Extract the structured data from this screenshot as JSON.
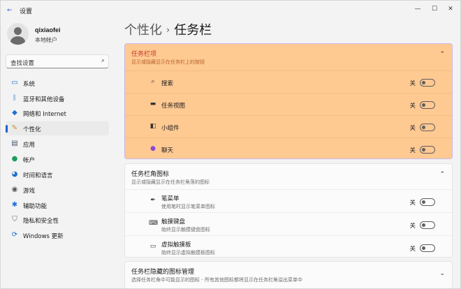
{
  "window": {
    "title": "设置",
    "app_icon": "back-arrow-icon",
    "buttons": {
      "minimize": "—",
      "maximize": "☐",
      "close": "✕"
    }
  },
  "user": {
    "name": "qixiaofei",
    "account_type": "本地帐户"
  },
  "search": {
    "placeholder": "查找设置",
    "icon": "search-icon"
  },
  "sidebar": {
    "items": [
      {
        "label": "系统",
        "icon": "monitor-icon",
        "active": false
      },
      {
        "label": "蓝牙和其他设备",
        "icon": "bluetooth-icon",
        "active": false
      },
      {
        "label": "网络和 Internet",
        "icon": "wifi-icon",
        "active": false
      },
      {
        "label": "个性化",
        "icon": "brush-icon",
        "active": true
      },
      {
        "label": "应用",
        "icon": "apps-icon",
        "active": false
      },
      {
        "label": "帐户",
        "icon": "person-icon",
        "active": false
      },
      {
        "label": "时间和语言",
        "icon": "globe-clock-icon",
        "active": false
      },
      {
        "label": "游戏",
        "icon": "gamepad-icon",
        "active": false
      },
      {
        "label": "辅助功能",
        "icon": "accessibility-icon",
        "active": false
      },
      {
        "label": "隐私和安全性",
        "icon": "shield-icon",
        "active": false
      },
      {
        "label": "Windows 更新",
        "icon": "update-icon",
        "active": false
      }
    ]
  },
  "page": {
    "breadcrumb_parent": "个性化",
    "breadcrumb_separator": "›",
    "title": "任务栏"
  },
  "sections": {
    "taskbar_items": {
      "title": "任务栏项",
      "subtitle": "显示或隐藏显示在任务栏上的按钮",
      "expanded": true,
      "highlight_color": "#ffc992",
      "rows": [
        {
          "label": "搜索",
          "icon": "search-icon",
          "state": "关",
          "on": false
        },
        {
          "label": "任务视图",
          "icon": "task-view-icon",
          "state": "关",
          "on": false
        },
        {
          "label": "小组件",
          "icon": "widgets-icon",
          "state": "关",
          "on": false
        },
        {
          "label": "聊天",
          "icon": "chat-icon",
          "state": "关",
          "on": false
        }
      ]
    },
    "corner_icons": {
      "title": "任务栏角图标",
      "subtitle": "显示或隐藏显示在任务栏角落的图标",
      "expanded": true,
      "rows": [
        {
          "label": "笔菜单",
          "sub": "使用笔时显示笔菜单图标",
          "icon": "pen-icon",
          "state": "关",
          "on": false
        },
        {
          "label": "触摸键盘",
          "sub": "始终显示触摸键盘图标",
          "icon": "keyboard-icon",
          "state": "关",
          "on": false
        },
        {
          "label": "虚拟触摸板",
          "sub": "始终显示虚拟触摸板图标",
          "icon": "touchpad-icon",
          "state": "关",
          "on": false
        }
      ]
    },
    "overflow": {
      "title": "任务栏隐藏的图标管理",
      "subtitle": "选择任务栏角中可能显示的图标 - 所有其他图标都将显示在任务栏角溢出菜单中",
      "expanded": false
    }
  },
  "colors": {
    "accent": "#1a63c9",
    "highlight": "#ffc992",
    "highlight_border": "#c9b7e8",
    "card_bg": "#fbfbfb",
    "window_bg": "#f3f3f3"
  }
}
